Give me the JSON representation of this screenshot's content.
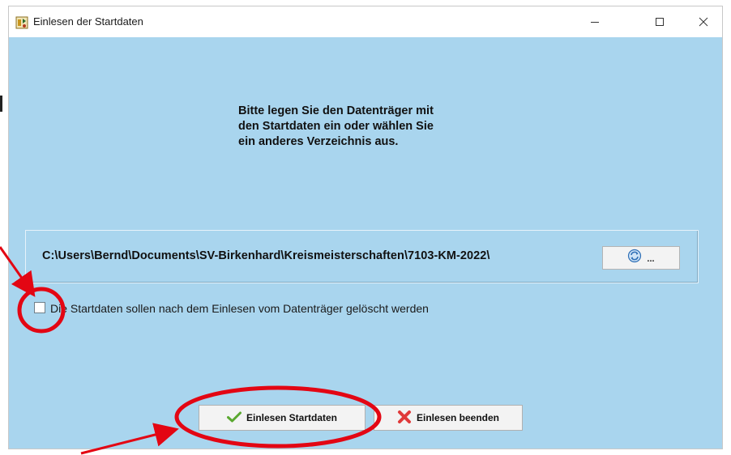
{
  "window": {
    "title": "Einlesen der Startdaten"
  },
  "title_controls": {
    "minimize": "—",
    "maximize": "☐",
    "close": "✕"
  },
  "message": {
    "lines": [
      "Bitte legen Sie den Datenträger mit",
      "den Startdaten ein oder wählen Sie",
      "ein anderes Verzeichnis aus."
    ]
  },
  "path": {
    "value": "C:\\Users\\Bernd\\Documents\\SV-Birkenhard\\Kreismeisterschaften\\7103-KM-2022\\",
    "browse_label": "..."
  },
  "delete_option": {
    "checked": false,
    "label": "Die Startdaten sollen nach dem Einlesen vom Datenträger gelöscht werden"
  },
  "buttons": {
    "read": "Einlesen Startdaten",
    "end": "Einlesen beenden"
  },
  "colors": {
    "window_bg": "#a9d5ee",
    "annotation": "#e30613",
    "check_icon": "#5aa830",
    "cancel_icon": "#e03a3a"
  },
  "icons": {
    "app": "program-icon",
    "browse": "refresh-folder-icon",
    "read": "checkmark-icon",
    "end": "red-x-icon"
  }
}
